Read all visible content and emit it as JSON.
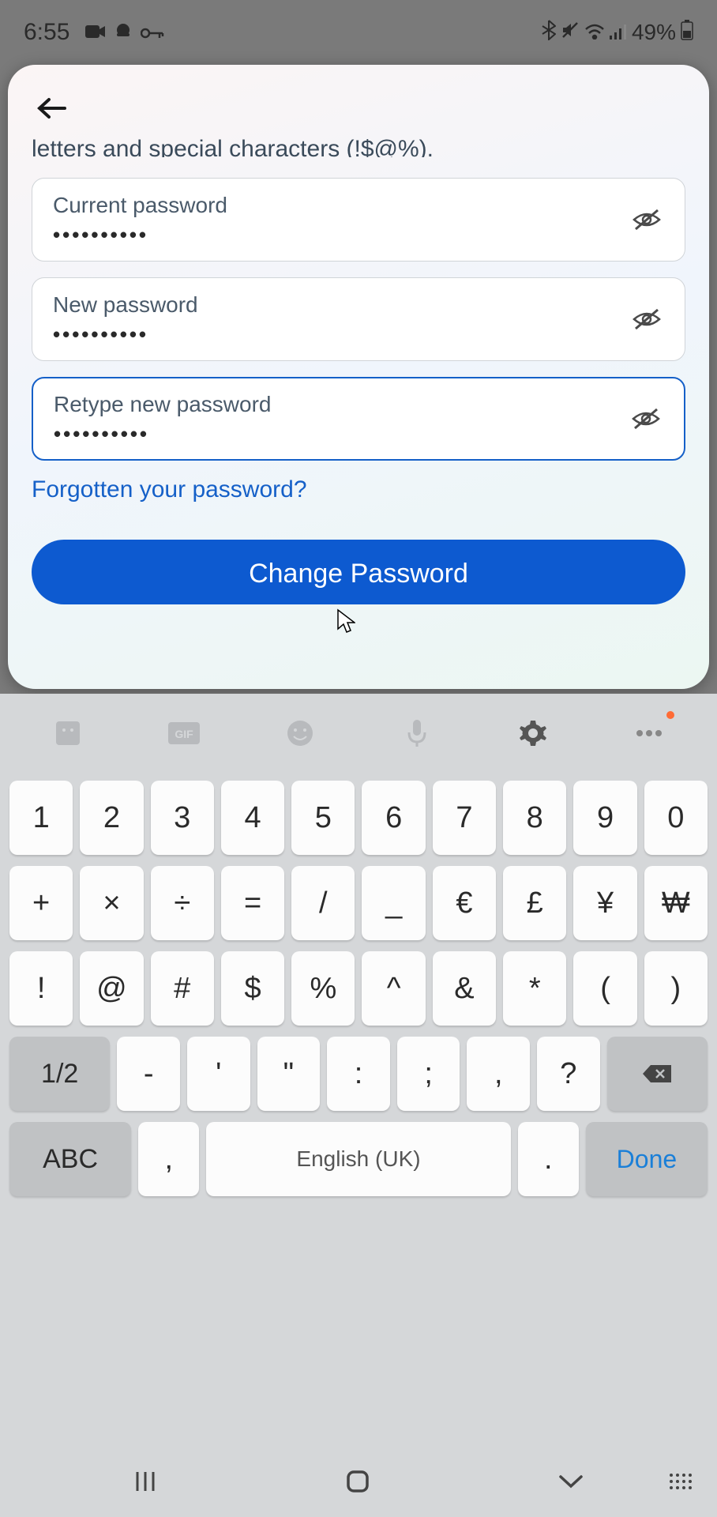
{
  "status": {
    "time": "6:55",
    "battery": "49%"
  },
  "form": {
    "instruction": "letters and special characters (!$@%).",
    "current_label": "Current password",
    "current_value": "••••••••••",
    "new_label": "New password",
    "new_value": "••••••••••",
    "retype_label": "Retype new password",
    "retype_value": "••••••••••",
    "forgot": "Forgotten your password?",
    "button": "Change Password"
  },
  "keyboard": {
    "row1": [
      "1",
      "2",
      "3",
      "4",
      "5",
      "6",
      "7",
      "8",
      "9",
      "0"
    ],
    "row2": [
      "+",
      "×",
      "÷",
      "=",
      "/",
      "_",
      "€",
      "£",
      "¥",
      "₩"
    ],
    "row3": [
      "!",
      "@",
      "#",
      "$",
      "%",
      "^",
      "&",
      "*",
      "(",
      ")"
    ],
    "row4_shift": "1/2",
    "row4": [
      "-",
      "'",
      "\"",
      ":",
      ";",
      ",",
      "?"
    ],
    "row5_abc": "ABC",
    "row5_comma": ",",
    "row5_space": "English (UK)",
    "row5_period": ".",
    "row5_done": "Done"
  }
}
